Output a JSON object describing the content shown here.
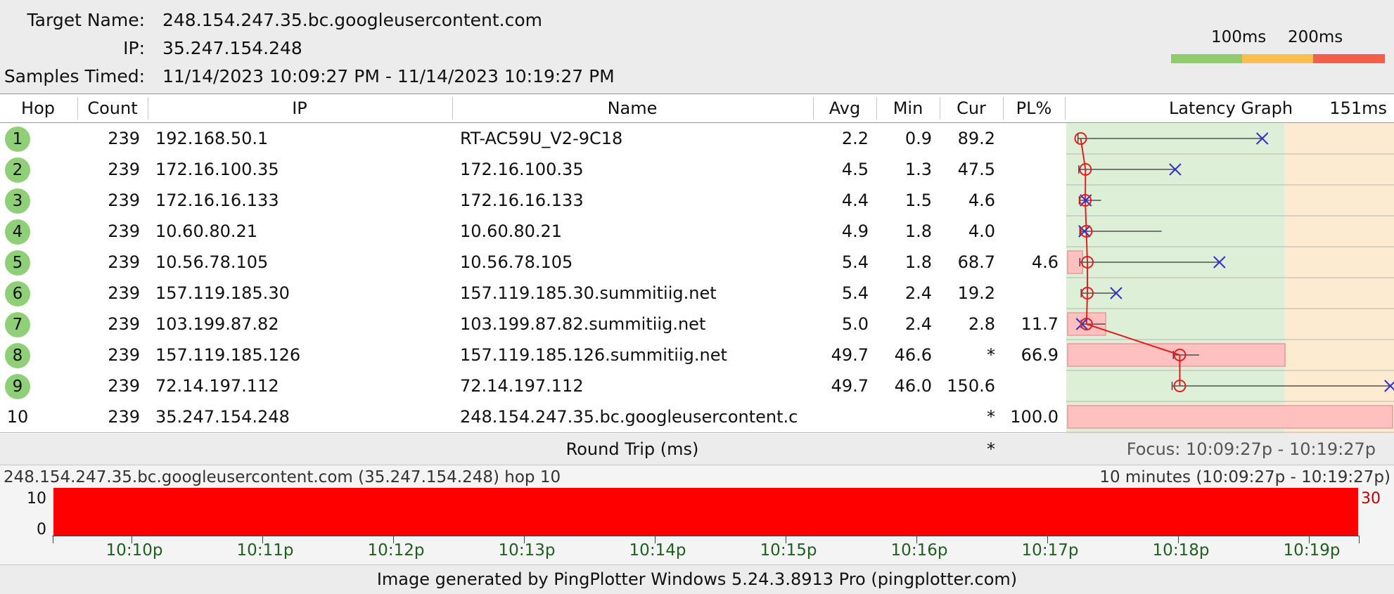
{
  "header": {
    "target_label": "Target Name:",
    "target_value": "248.154.247.35.bc.googleusercontent.com",
    "ip_label": "IP:",
    "ip_value": "35.247.154.248",
    "samples_label": "Samples Timed:",
    "samples_value": "11/14/2023 10:09:27 PM - 11/14/2023 10:19:27 PM",
    "scale_100": "100ms",
    "scale_200": "200ms",
    "scale_colors": [
      "#92cc6a",
      "#fbbd4c",
      "#f2604a"
    ]
  },
  "columns": {
    "hop": "Hop",
    "count": "Count",
    "ip": "IP",
    "name": "Name",
    "avg": "Avg",
    "min": "Min",
    "cur": "Cur",
    "pl": "PL%",
    "graph": "Latency Graph",
    "graph_max": "151ms"
  },
  "rows": [
    {
      "hop": "1",
      "count": "239",
      "ip": "192.168.50.1",
      "name": "RT-AC59U_V2-9C18",
      "avg": "2.2",
      "min": "0.9",
      "cur": "89.2",
      "pl": "",
      "ok": true
    },
    {
      "hop": "2",
      "count": "239",
      "ip": "172.16.100.35",
      "name": "172.16.100.35",
      "avg": "4.5",
      "min": "1.3",
      "cur": "47.5",
      "pl": "",
      "ok": true
    },
    {
      "hop": "3",
      "count": "239",
      "ip": "172.16.16.133",
      "name": "172.16.16.133",
      "avg": "4.4",
      "min": "1.5",
      "cur": "4.6",
      "pl": "",
      "ok": true
    },
    {
      "hop": "4",
      "count": "239",
      "ip": "10.60.80.21",
      "name": "10.60.80.21",
      "avg": "4.9",
      "min": "1.8",
      "cur": "4.0",
      "pl": "",
      "ok": true
    },
    {
      "hop": "5",
      "count": "239",
      "ip": "10.56.78.105",
      "name": "10.56.78.105",
      "avg": "5.4",
      "min": "1.8",
      "cur": "68.7",
      "pl": "4.6",
      "ok": true
    },
    {
      "hop": "6",
      "count": "239",
      "ip": "157.119.185.30",
      "name": "157.119.185.30.summitiig.net",
      "avg": "5.4",
      "min": "2.4",
      "cur": "19.2",
      "pl": "",
      "ok": true
    },
    {
      "hop": "7",
      "count": "239",
      "ip": "103.199.87.82",
      "name": "103.199.87.82.summitiig.net",
      "avg": "5.0",
      "min": "2.4",
      "cur": "2.8",
      "pl": "11.7",
      "ok": true
    },
    {
      "hop": "8",
      "count": "239",
      "ip": "157.119.185.126",
      "name": "157.119.185.126.summitiig.net",
      "avg": "49.7",
      "min": "46.6",
      "cur": "*",
      "pl": "66.9",
      "ok": true
    },
    {
      "hop": "9",
      "count": "239",
      "ip": "72.14.197.112",
      "name": "72.14.197.112",
      "avg": "49.7",
      "min": "46.0",
      "cur": "150.6",
      "pl": "",
      "ok": true
    },
    {
      "hop": "10",
      "count": "239",
      "ip": "35.247.154.248",
      "name": "248.154.247.35.bc.googleusercontent.c",
      "avg": "",
      "min": "",
      "cur": "*",
      "pl": "100.0",
      "ok": false
    }
  ],
  "graph": {
    "max_ms": 151,
    "green_until_ms": 100,
    "yellow_until_ms": 151,
    "zone_colors": {
      "green": "#ddefd6",
      "yellow": "#fdebd1",
      "loss": "#ffc0c0"
    },
    "hops": [
      {
        "avg": 2.2,
        "min": 0.9,
        "max": 89.2,
        "cur": 89.2,
        "pl": 0
      },
      {
        "avg": 4.5,
        "min": 1.3,
        "max": 47.5,
        "cur": 47.5,
        "pl": 0
      },
      {
        "avg": 4.4,
        "min": 1.5,
        "max": 12,
        "cur": 4.6,
        "pl": 0
      },
      {
        "avg": 4.9,
        "min": 1.8,
        "max": 41,
        "cur": 4.0,
        "pl": 0
      },
      {
        "avg": 5.4,
        "min": 1.8,
        "max": 68.7,
        "cur": 68.7,
        "pl": 4.6
      },
      {
        "avg": 5.4,
        "min": 2.4,
        "max": 19.2,
        "cur": 19.2,
        "pl": 0
      },
      {
        "avg": 5.0,
        "min": 2.4,
        "max": 14,
        "cur": 2.8,
        "pl": 11.7
      },
      {
        "avg": 49.7,
        "min": 46.6,
        "max": 59,
        "cur": null,
        "pl": 66.9
      },
      {
        "avg": 49.7,
        "min": 46.0,
        "max": 150.6,
        "cur": 150.6,
        "pl": 0
      },
      {
        "avg": null,
        "min": null,
        "max": null,
        "cur": null,
        "pl": 100
      }
    ]
  },
  "round_trip": {
    "label": "Round Trip (ms)",
    "cur": "*",
    "focus": "Focus: 10:09:27p - 10:19:27p"
  },
  "timeline": {
    "left_title": "248.154.247.35.bc.googleusercontent.com (35.247.154.248) hop 10",
    "right_title": "10 minutes (10:09:27p - 10:19:27p)",
    "y_top": "10",
    "y_bottom": "0",
    "right_value": "30",
    "bar_color": "#ff0000",
    "ticks": [
      "10:10p",
      "10:11p",
      "10:12p",
      "10:13p",
      "10:14p",
      "10:15p",
      "10:16p",
      "10:17p",
      "10:18p",
      "10:19p"
    ]
  },
  "footer": "Image generated by PingPlotter Windows 5.24.3.8913 Pro (pingplotter.com)"
}
